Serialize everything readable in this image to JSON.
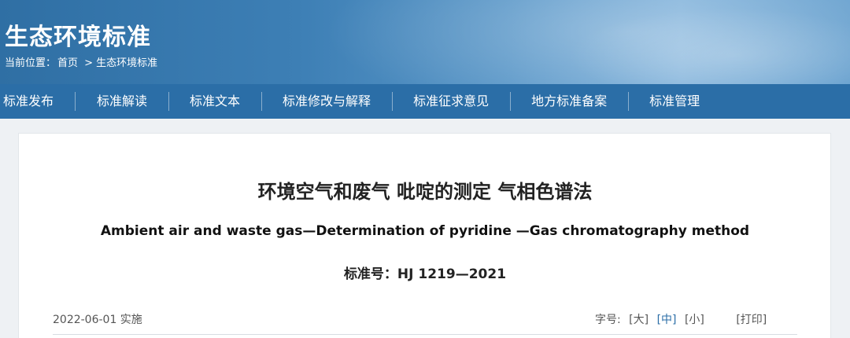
{
  "header": {
    "site_title": "生态环境标准",
    "breadcrumb": {
      "prefix": "当前位置：",
      "home": "首页",
      "separator": ">",
      "current": "生态环境标准"
    }
  },
  "nav": {
    "items": [
      {
        "label": "标准发布"
      },
      {
        "label": "标准解读"
      },
      {
        "label": "标准文本"
      },
      {
        "label": "标准修改与解释"
      },
      {
        "label": "标准征求意见"
      },
      {
        "label": "地方标准备案"
      },
      {
        "label": "标准管理"
      }
    ]
  },
  "document": {
    "title_cn": "环境空气和废气 吡啶的测定 气相色谱法",
    "title_en": "Ambient air and waste gas—Determination of pyridine —Gas chromatography method",
    "standard_number": "标准号：HJ 1219—2021",
    "effective_date": "2022-06-01 实施"
  },
  "toolbar": {
    "font_label": "字号:",
    "large": "[大]",
    "medium": "[中]",
    "small": "[小]",
    "print": "[打印]",
    "active_color": "#2b6ea7"
  },
  "colors": {
    "nav_bg": "#2b6ea7",
    "banner": "#3d7fb5"
  }
}
